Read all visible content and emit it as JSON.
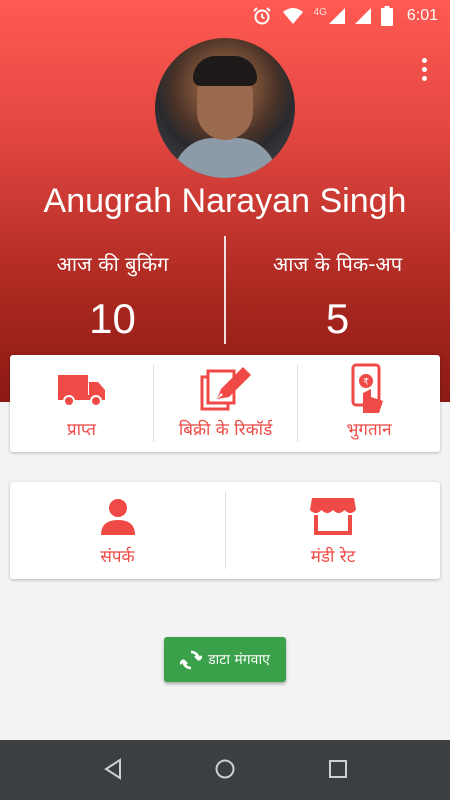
{
  "status_bar": {
    "network": "4G",
    "time": "6:01",
    "icons": [
      "alarm-icon",
      "wifi-icon",
      "signal-icon",
      "signal-icon",
      "battery-icon"
    ]
  },
  "profile": {
    "name": "Anugrah Narayan Singh"
  },
  "stats": {
    "bookings_label": "आज की बुकिंग",
    "bookings_value": "10",
    "pickups_label": "आज के पिक-अप",
    "pickups_value": "5"
  },
  "actions_row1": [
    {
      "label": "प्राप्त",
      "icon": "truck-icon"
    },
    {
      "label": "बिक्री के रिकॉर्ड",
      "icon": "edit-record-icon"
    },
    {
      "label": "भुगतान",
      "icon": "payment-phone-icon"
    }
  ],
  "actions_row2": [
    {
      "label": "संपर्क",
      "icon": "person-icon"
    },
    {
      "label": "मंडी रेट",
      "icon": "market-store-icon"
    }
  ],
  "fetch_button": {
    "label": "डाटा मंगवाए",
    "icon": "refresh-icon"
  },
  "colors": {
    "accent": "#ef4a45",
    "header_top": "#ff5a52",
    "header_bottom": "#8c1a14",
    "button_green": "#3aa04a",
    "navbar": "#3c3f41"
  }
}
